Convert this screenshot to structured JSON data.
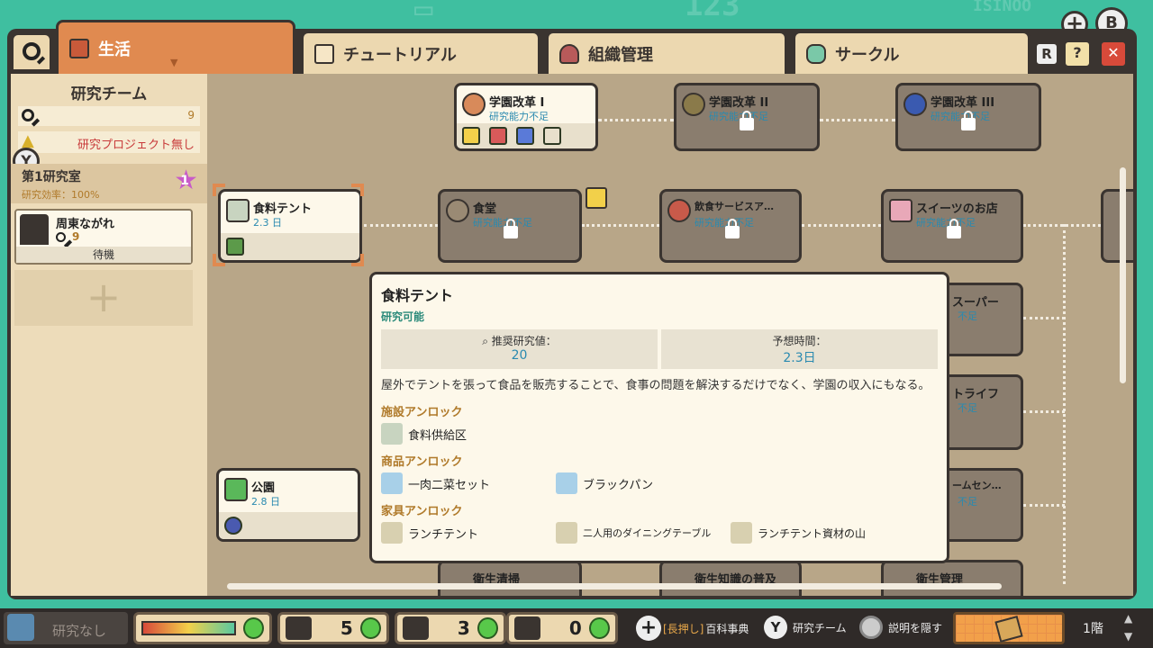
{
  "tabs": [
    {
      "label": "生活",
      "icon": "briefcase-icon"
    },
    {
      "label": "チュートリアル",
      "icon": "calendar-icon"
    },
    {
      "label": "組織管理",
      "icon": "trophy-icon"
    },
    {
      "label": "サークル",
      "icon": "glove-icon"
    }
  ],
  "top_buttons": {
    "b": "B",
    "r": "R",
    "plus": "+"
  },
  "sidebar": {
    "title": "研究チーム",
    "research_value": "9",
    "no_project": "研究プロジェクト無し",
    "y_button": "Y",
    "lab_name": "第1研究室",
    "lab_eff": "研究効率：100%",
    "lab_badge": "1",
    "member": {
      "name": "周東ながれ",
      "value": "9",
      "status": "待機"
    }
  },
  "cards": {
    "gakuen1": {
      "title": "学園改革 I",
      "sub": "研究能力不足"
    },
    "gakuen2": {
      "title": "学園改革 II",
      "sub": "研究能力不足"
    },
    "gakuen3": {
      "title": "学園改革 III",
      "sub": "研究能力不足"
    },
    "tent": {
      "title": "食料テント",
      "sub": "2.3 日"
    },
    "shokudo": {
      "title": "食堂",
      "sub": "研究能力不足"
    },
    "inshoku": {
      "title": "飲食サービスア…",
      "sub": "研究能力不足"
    },
    "sweets": {
      "title": "スイーツのお店",
      "sub": "研究能力不足"
    },
    "super": {
      "title": "スーパー",
      "sub": "不足"
    },
    "life": {
      "title": "トライフ",
      "sub": "不足"
    },
    "game": {
      "title": "ームセン…",
      "sub": "不足"
    },
    "park": {
      "title": "公園",
      "sub": "2.8 日"
    },
    "eisei1": {
      "title": "衛生清掃"
    },
    "eisei2": {
      "title": "衛生知識の普及"
    },
    "eisei3": {
      "title": "衛生管理"
    }
  },
  "tooltip": {
    "title": "食料テント",
    "status": "研究可能",
    "stat1_label": "推奨研究値：",
    "stat1_value": "20",
    "stat2_label": "予想時間：",
    "stat2_value": "2.3日",
    "description": "屋外でテントを張って食品を販売することで、食事の問題を解決するだけでなく、学園の収入にもなる。",
    "facility_header": "施設アンロック",
    "facilities": [
      "食料供給区"
    ],
    "goods_header": "商品アンロック",
    "goods": [
      "一肉二菜セット",
      "ブラックパン"
    ],
    "furniture_header": "家具アンロック",
    "furniture": [
      "ランチテント",
      "二人用のダイニングテーブル",
      "ランチテント資材の山"
    ]
  },
  "bottom": {
    "search_text": "研究なし",
    "count1": "5",
    "count2": "3",
    "count3": "0",
    "hint_long": "[長押し]",
    "hint_encyclopedia": "百科事典",
    "hint_y": "Y",
    "hint_team": "研究チーム",
    "hint_hide": "説明を隠す",
    "floor": "1階"
  },
  "colors": {
    "background": "#3fbfa0",
    "active_tab": "#e08a50",
    "panel": "#eddcba",
    "accent_text": "#2a8ab0"
  }
}
